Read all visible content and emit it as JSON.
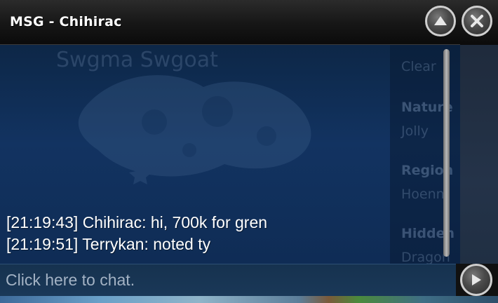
{
  "window": {
    "title": "MSG - Chihirac",
    "minimize_icon": "chevron-up-icon",
    "close_icon": "close-icon"
  },
  "messages": [
    {
      "time": "[21:19:43]",
      "sender": "Chihirac",
      "text": "hi, 700k for gren"
    },
    {
      "time": "[21:19:51]",
      "sender": "Terrykan",
      "text": "noted ty"
    }
  ],
  "message_lines": [
    "[21:19:43] Chihirac: hi, 700k for gren",
    "[21:19:51] Terrykan: noted ty"
  ],
  "input": {
    "placeholder": "Click here to chat.",
    "value": ""
  },
  "send_icon": "play-arrow-icon",
  "background": {
    "map_title": "Swgma Swgoat",
    "side_labels": [
      "Nature",
      "Region",
      "Hidden"
    ],
    "side_values": [
      "Clear",
      "Jolly",
      "Hoenn",
      "Dragon"
    ]
  },
  "colors": {
    "titlebar": "#161616",
    "chat_bg": "#123361",
    "text": "#ffffff",
    "placeholder": "#a3b2c4"
  }
}
